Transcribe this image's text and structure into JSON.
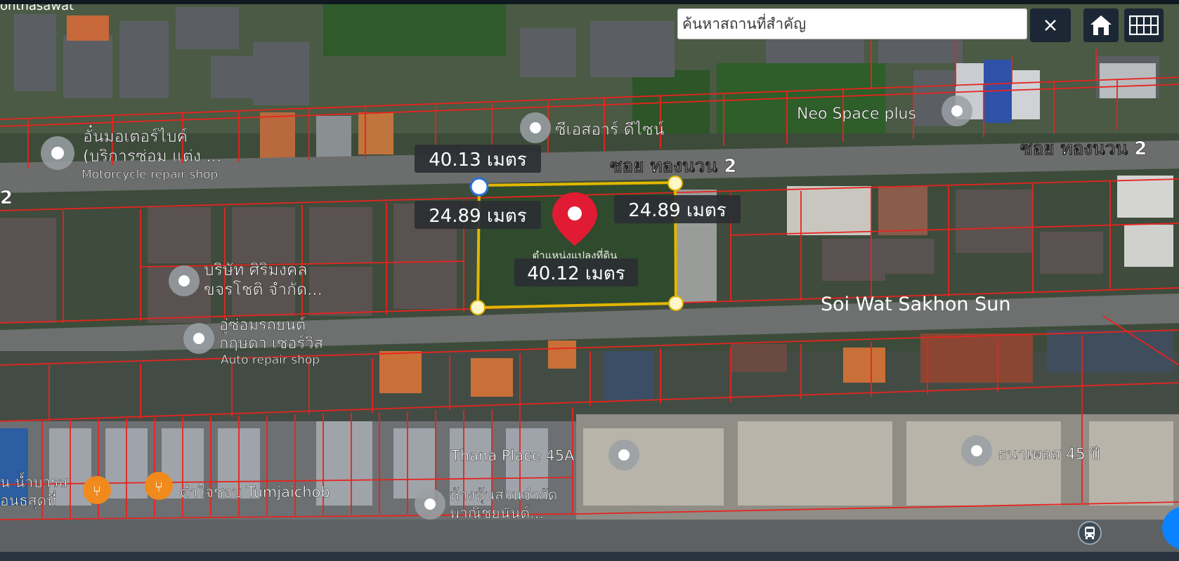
{
  "search": {
    "placeholder": "ค้นหาสถานที่สำคัญ",
    "value": ""
  },
  "icons": {
    "clear": "close-icon",
    "home": "home-icon",
    "grid": "grid-icon",
    "bus": "bus-icon",
    "pin": "location-pin-icon",
    "poi": "poi-pin-icon",
    "restaurant": "restaurant-icon"
  },
  "colors": {
    "parcel_line": "#e8231e",
    "selection": "#e2b600",
    "pin": "#e01b33",
    "label_bg": "#2b2f33",
    "button_bg": "#1c2735",
    "fab": "#0b82ff"
  },
  "measurements": {
    "top": "40.13 เมตร",
    "left": "24.89 เมตร",
    "right": "24.89 เมตร",
    "bottom": "40.12 เมตร"
  },
  "roads": {
    "soi_right": "ซอย ทองนวน 2",
    "soi_center": "ซอย ทองนวน 2",
    "soi_left": "2",
    "wat": "Soi Wat Sakhon Sun",
    "top_left": "onthasawat"
  },
  "places": {
    "neo": "Neo Space plus",
    "cs": "ซีเอสอาร์ ดีไซน์",
    "moto_th1": "อั๋นมอเตอร์ไบค์",
    "moto_th2": "(บริการซ่อม แต่ง ...",
    "moto_en": "Motorcycle repair shop",
    "siri1": "บริษัท ศิริมงคล",
    "siri2": "ขจรโชติ จำกัด...",
    "auto_th1": "อู่ซ่อมรถยนต์",
    "auto_th2": "กฤษดา เซอร์วิส",
    "auto_en": "Auto repair shop",
    "parcel": "ตำแหน่งแปลงที่ดิน",
    "thana_en": "Thana Place 45A",
    "thana_th": "ธนาเพลส 45 ปี",
    "tumjai": "ตำใจชอบ Tumjaichob",
    "left_bottom1": "น น้ำบารส",
    "left_bottom2": "อนธสุดที่",
    "shop1": "ห้างหุ้นส่วนจำกัด",
    "shop2": "พาณิชยนันต์..."
  }
}
